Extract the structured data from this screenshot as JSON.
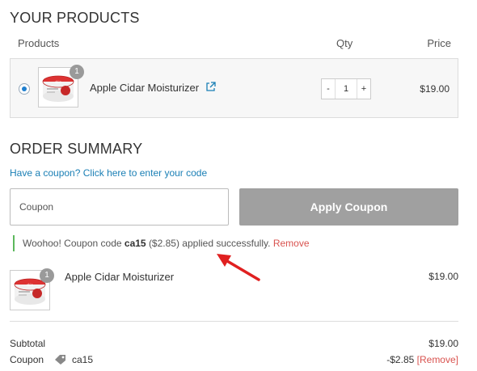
{
  "your_products": {
    "title": "YOUR PRODUCTS",
    "columns": {
      "products": "Products",
      "qty": "Qty",
      "price": "Price"
    },
    "item": {
      "badge": "1",
      "name": "Apple Cidar Moisturizer",
      "qty_minus": "-",
      "qty_value": "1",
      "qty_plus": "+",
      "price": "$19.00",
      "link_icon": "external-link-icon"
    }
  },
  "order_summary": {
    "title": "ORDER SUMMARY",
    "coupon_prompt": "Have a coupon? Click here to enter your code",
    "coupon_placeholder": "Coupon",
    "apply_label": "Apply Coupon",
    "success": {
      "prefix": "Woohoo! Coupon code",
      "code": "ca15",
      "suffix": "($2.85) applied successfully.",
      "remove_label": "Remove"
    },
    "line_item": {
      "badge": "1",
      "name": "Apple Cidar Moisturizer",
      "price": "$19.00"
    },
    "totals": {
      "subtotal_label": "Subtotal",
      "subtotal_value": "$19.00",
      "coupon_label": "Coupon",
      "coupon_code": "ca15",
      "coupon_value": "-$2.85",
      "coupon_remove": "[Remove]",
      "tag_icon": "tag-icon"
    }
  },
  "colors": {
    "link": "#1a7fb5",
    "remove": "#d9534f",
    "success_bar": "#5cb85c",
    "button_disabled": "#a0a0a0",
    "annotation_arrow": "#e02020"
  }
}
